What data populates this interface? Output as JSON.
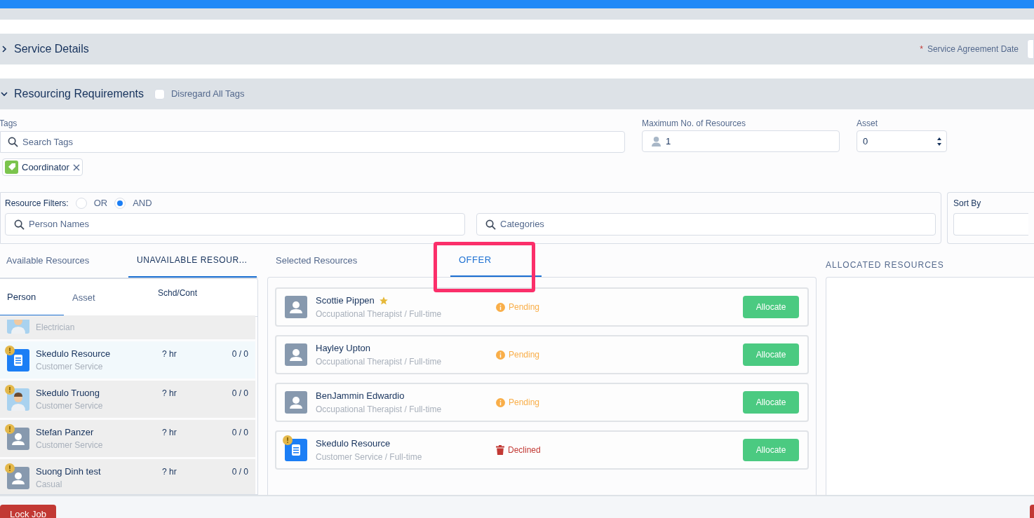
{
  "service_details": {
    "title": "Service Details",
    "expanded": false,
    "required_mark": "*",
    "date_label": "Service Agreement Date"
  },
  "resourcing": {
    "title": "Resourcing Requirements",
    "expanded": true,
    "disregard_tags": {
      "label": "Disregard All Tags",
      "checked": false
    }
  },
  "tags": {
    "label": "Tags",
    "placeholder": "Search Tags",
    "chips": [
      "Coordinator"
    ]
  },
  "max_resources": {
    "label": "Maximum No. of Resources",
    "value": "1"
  },
  "asset": {
    "label": "Asset",
    "value": "0"
  },
  "resource_filters": {
    "label": "Resource Filters:",
    "options": [
      {
        "label": "OR",
        "selected": false
      },
      {
        "label": "AND",
        "selected": true
      }
    ],
    "person_placeholder": "Person Names",
    "category_placeholder": "Categories"
  },
  "sort_by": {
    "label": "Sort By"
  },
  "left_tabs": [
    {
      "label": "Available Resources",
      "selected": false
    },
    {
      "label": "UNAVAILABLE RESOUR...",
      "selected": true
    }
  ],
  "left_subtabs": [
    {
      "label": "Person",
      "selected": true
    },
    {
      "label": "Asset",
      "selected": false
    }
  ],
  "left_column": "Schd/Cont",
  "left_rows": [
    {
      "kind": "photo",
      "warning": false,
      "role": "Electrician",
      "highlighted": false
    },
    {
      "kind": "document",
      "warning": true,
      "name": "Skedulo Resource",
      "role": "Customer Service",
      "hours": "? hr",
      "count": "0 / 0",
      "highlighted": true
    },
    {
      "kind": "photo",
      "warning": true,
      "name": "Skedulo Truong",
      "role": "Customer Service",
      "hours": "? hr",
      "count": "0 / 0",
      "highlighted": false
    },
    {
      "kind": "person",
      "warning": true,
      "name": "Stefan Panzer",
      "role": "Customer Service",
      "hours": "? hr",
      "count": "0 / 0",
      "highlighted": false
    },
    {
      "kind": "person",
      "warning": true,
      "name": "Suong Dinh test",
      "role": "Casual",
      "hours": "? hr",
      "count": "0 / 0",
      "highlighted": false
    }
  ],
  "middle_tabs": [
    {
      "label": "Selected Resources",
      "selected": false,
      "annotated": false
    },
    {
      "label": "OFFER",
      "selected": true,
      "annotated": true
    }
  ],
  "offers": [
    {
      "kind": "person",
      "warning": false,
      "starred": true,
      "name": "Scottie Pippen",
      "role": "Occupational Therapist / Full-time",
      "status": {
        "kind": "pending",
        "label": "Pending"
      },
      "action": "Allocate"
    },
    {
      "kind": "person",
      "warning": false,
      "starred": false,
      "name": "Hayley Upton",
      "role": "Occupational Therapist / Full-time",
      "status": {
        "kind": "pending",
        "label": "Pending"
      },
      "action": "Allocate"
    },
    {
      "kind": "person",
      "warning": false,
      "starred": false,
      "name": "BenJammin Edwardio",
      "role": "Occupational Therapist / Full-time",
      "status": {
        "kind": "pending",
        "label": "Pending"
      },
      "action": "Allocate"
    },
    {
      "kind": "document",
      "warning": true,
      "starred": false,
      "name": "Skedulo Resource",
      "role": "Customer Service / Full-time",
      "status": {
        "kind": "declined",
        "label": "Declined"
      },
      "action": "Allocate"
    }
  ],
  "allocated_title": "ALLOCATED RESOURCES",
  "footer": {
    "lock_button": "Lock Job"
  }
}
